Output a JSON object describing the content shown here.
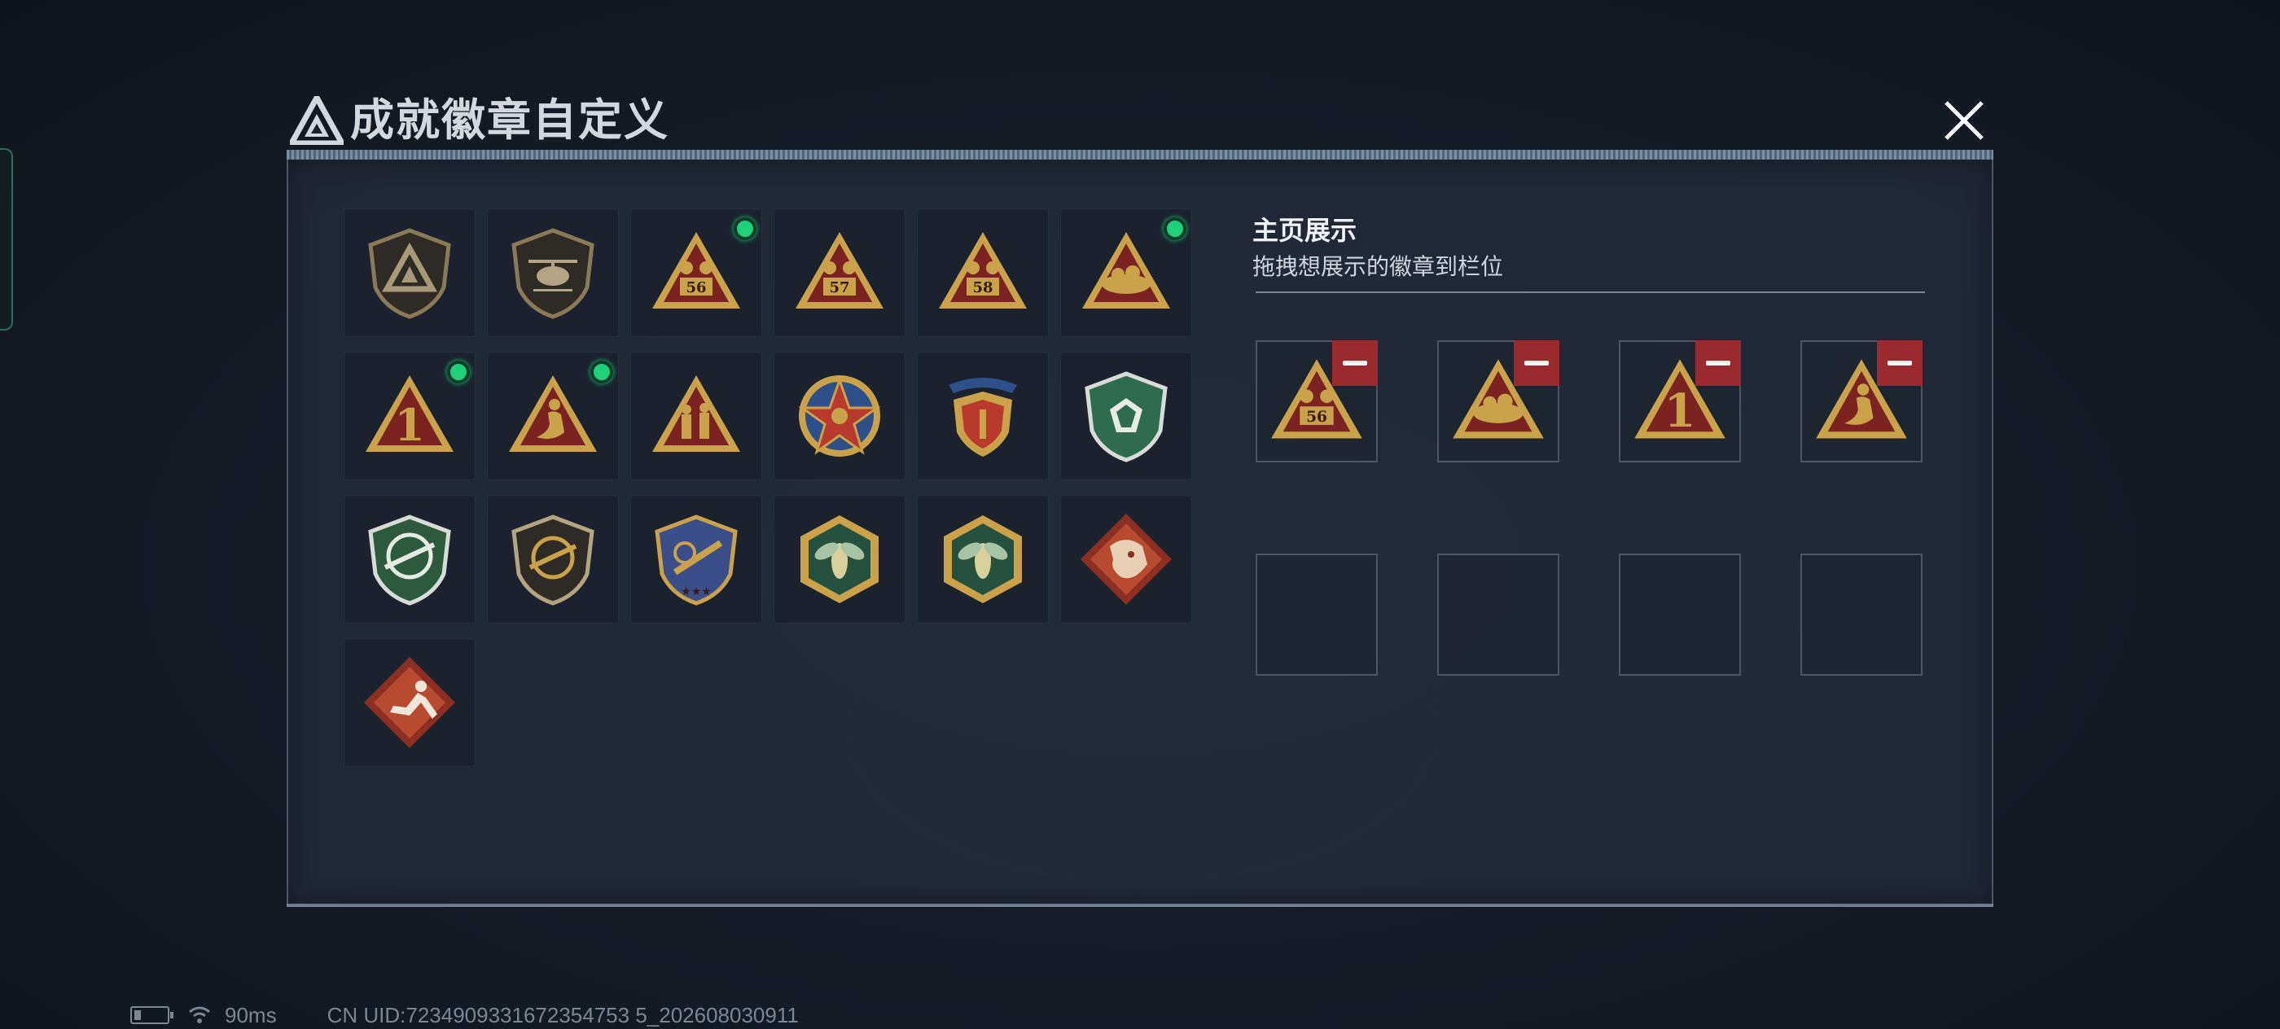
{
  "header": {
    "title": "成就徽章自定义",
    "logo_icon": "triangle-logo-icon",
    "close_icon": "close-icon"
  },
  "colors": {
    "equipped_dot": "#1ed17a",
    "remove_button": "#9a2a2f",
    "panel": "#242c3a"
  },
  "collection": {
    "badges": [
      {
        "name": "triangle-shield-badge-icon",
        "equipped": false
      },
      {
        "name": "helicopter-shield-badge-icon",
        "equipped": false
      },
      {
        "name": "triangle-56-badge-icon",
        "label": "56",
        "equipped": true
      },
      {
        "name": "triangle-57-badge-icon",
        "label": "57",
        "equipped": false
      },
      {
        "name": "triangle-58-badge-icon",
        "label": "58",
        "equipped": false
      },
      {
        "name": "triangle-nest-badge-icon",
        "equipped": true
      },
      {
        "name": "triangle-number-one-badge-icon",
        "label": "1",
        "equipped": true
      },
      {
        "name": "triangle-mermaid-badge-icon",
        "equipped": true
      },
      {
        "name": "triangle-soldiers-badge-icon",
        "equipped": false
      },
      {
        "name": "star-compass-badge-icon",
        "equipped": false
      },
      {
        "name": "laurel-shield-badge-icon",
        "equipped": false
      },
      {
        "name": "green-gem-shield-badge-icon",
        "equipped": false
      },
      {
        "name": "green-crosshair-rifle-badge-icon",
        "equipped": false
      },
      {
        "name": "crosshair-rifle-shield-badge-icon",
        "equipped": false
      },
      {
        "name": "rifle-stars-shield-badge-icon",
        "equipped": false
      },
      {
        "name": "hexagon-wasp-badge-icon",
        "equipped": false
      },
      {
        "name": "hexagon-wasp-green-badge-icon",
        "equipped": false
      },
      {
        "name": "diamond-dragon-badge-icon",
        "equipped": false
      },
      {
        "name": "diamond-runner-badge-icon",
        "equipped": false
      }
    ]
  },
  "showcase": {
    "title": "主页展示",
    "subtitle": "拖拽想展示的徽章到栏位",
    "slots": [
      {
        "badge": "triangle-56-badge-icon",
        "label": "56"
      },
      {
        "badge": "triangle-nest-badge-icon"
      },
      {
        "badge": "triangle-number-one-badge-icon",
        "label": "1"
      },
      {
        "badge": "triangle-mermaid-badge-icon"
      },
      {
        "badge": null
      },
      {
        "badge": null
      },
      {
        "badge": null
      },
      {
        "badge": null
      }
    ]
  },
  "status": {
    "ping": "90ms",
    "uid": "CN UID:7234909331672354753 5_202608030911"
  }
}
